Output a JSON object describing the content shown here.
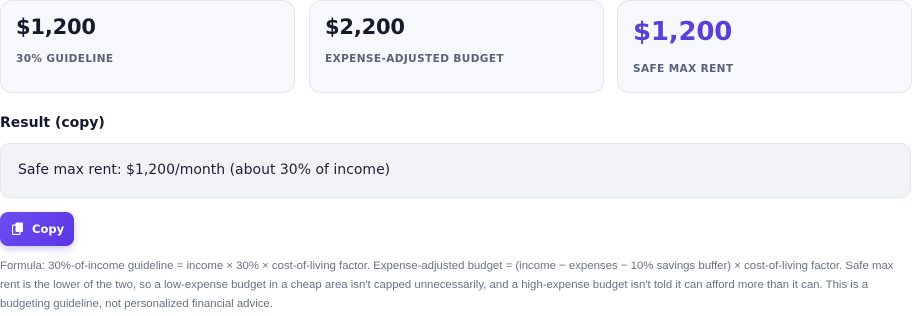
{
  "cards": [
    {
      "value": "$1,200",
      "label": "30% GUIDELINE"
    },
    {
      "value": "$2,200",
      "label": "EXPENSE-ADJUSTED BUDGET"
    },
    {
      "value": "$1,200",
      "label": "SAFE MAX RENT"
    }
  ],
  "result": {
    "heading": "Result (copy)",
    "text": "Safe max rent: $1,200/month (about 30% of income)"
  },
  "copy_button": {
    "label": "Copy",
    "icon": "copy-icon"
  },
  "formula_note": "Formula: 30%-of-income guideline = income × 30% × cost-of-living factor. Expense-adjusted budget = (income − expenses − 10% savings buffer) × cost-of-living factor. Safe max rent is the lower of the two, so a low-expense budget in a cheap area isn't capped unnecessarily, and a high-expense budget isn't told it can afford more than it can. This is a budgeting guideline, not personalized financial advice.",
  "colors": {
    "accent": "#5b35e6",
    "highlight_value": "#5a3fd9",
    "card_bg": "#f7f8fb"
  }
}
